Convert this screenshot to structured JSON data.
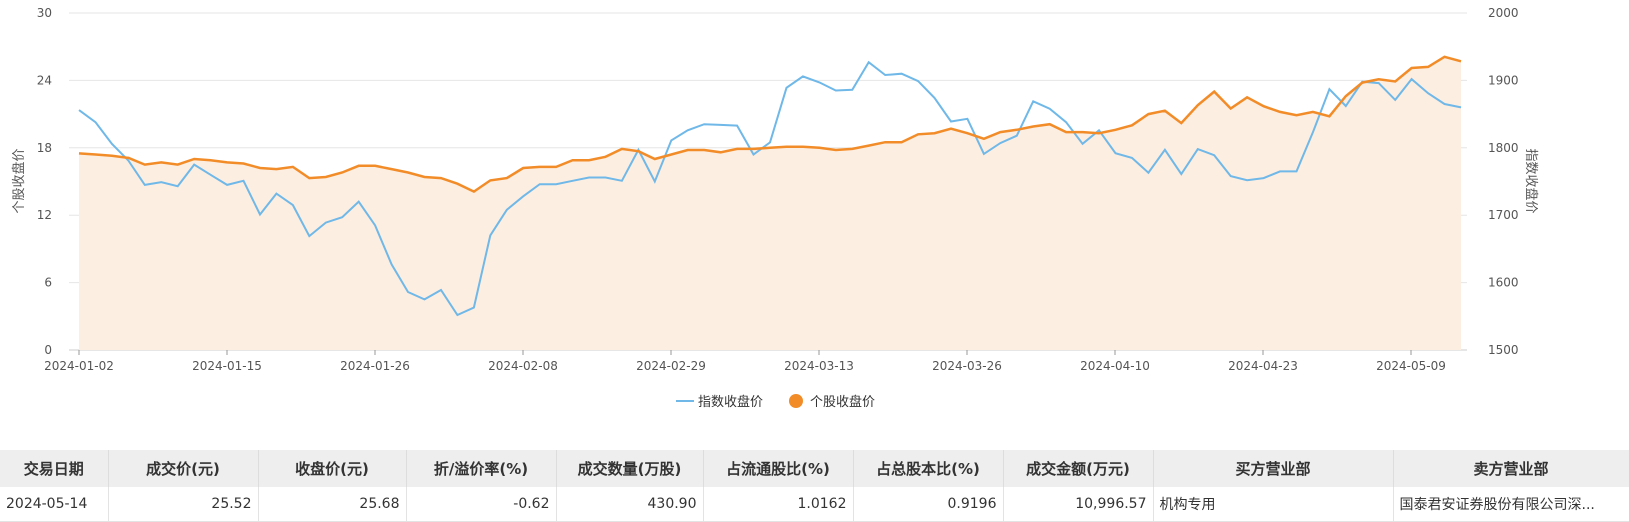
{
  "chart_data": {
    "type": "line",
    "legend": [
      "指数收盘价",
      "个股收盘价"
    ],
    "legend_position": "bottom-center",
    "grid": true,
    "y_left": {
      "label": "个股收盘价",
      "ylim": [
        0,
        30
      ],
      "ticks": [
        "30",
        "24",
        "18",
        "12",
        "6",
        "0"
      ]
    },
    "y_right": {
      "label": "指数收盘价",
      "ylim": [
        1500,
        2000
      ],
      "ticks": [
        "2000",
        "1900",
        "1800",
        "1700",
        "1600",
        "1500"
      ]
    },
    "x_ticks": [
      "2024-01-02",
      "2024-01-15",
      "2024-01-26",
      "2024-02-08",
      "2024-02-29",
      "2024-03-13",
      "2024-03-26",
      "2024-04-10",
      "2024-04-23",
      "2024-05-09"
    ],
    "series": [
      {
        "name": "指数收盘价",
        "axis": "right",
        "color": "#6fb8e8",
        "values": [
          1856,
          1838,
          1806,
          1781,
          1745,
          1749,
          1743,
          1775,
          1760,
          1745,
          1751,
          1701,
          1732,
          1715,
          1669,
          1689,
          1697,
          1720,
          1685,
          1627,
          1586,
          1575,
          1589,
          1552,
          1563,
          1670,
          1708,
          1728,
          1746,
          1746,
          1751,
          1756,
          1756,
          1751,
          1797,
          1750,
          1811,
          1826,
          1835,
          1834,
          1833,
          1790,
          1808,
          1889,
          1906,
          1897,
          1885,
          1886,
          1927,
          1908,
          1910,
          1899,
          1874,
          1839,
          1843,
          1791,
          1807,
          1818,
          1869,
          1858,
          1838,
          1806,
          1826,
          1792,
          1785,
          1763,
          1797,
          1761,
          1798,
          1789,
          1758,
          1752,
          1755,
          1765,
          1765,
          1823,
          1887,
          1862,
          1898,
          1896,
          1871,
          1902,
          1881,
          1865,
          1860
        ]
      },
      {
        "name": "个股收盘价",
        "axis": "left",
        "color": "#f28c28",
        "values": [
          17.5,
          17.4,
          17.3,
          17.1,
          16.5,
          16.7,
          16.5,
          17.0,
          16.9,
          16.7,
          16.6,
          16.2,
          16.1,
          16.3,
          15.3,
          15.4,
          15.8,
          16.4,
          16.4,
          16.1,
          15.8,
          15.4,
          15.3,
          14.8,
          14.1,
          15.1,
          15.3,
          16.2,
          16.3,
          16.3,
          16.9,
          16.9,
          17.2,
          17.9,
          17.7,
          17.0,
          17.4,
          17.8,
          17.8,
          17.6,
          17.9,
          17.9,
          18.0,
          18.1,
          18.1,
          18.0,
          17.8,
          17.9,
          18.2,
          18.5,
          18.5,
          19.2,
          19.3,
          19.7,
          19.3,
          18.8,
          19.4,
          19.6,
          19.9,
          20.1,
          19.4,
          19.4,
          19.3,
          19.6,
          20.0,
          21.0,
          21.3,
          20.2,
          21.8,
          23.0,
          21.5,
          22.5,
          21.7,
          21.2,
          20.9,
          21.2,
          20.8,
          22.6,
          23.8,
          24.1,
          23.9,
          25.1,
          25.2,
          26.1,
          25.7
        ]
      }
    ]
  },
  "table": {
    "headers": [
      "交易日期",
      "成交价(元)",
      "收盘价(元)",
      "折/溢价率(%)",
      "成交数量(万股)",
      "占流通股比(%)",
      "占总股本比(%)",
      "成交金额(万元)",
      "买方营业部",
      "卖方营业部"
    ],
    "rows": [
      [
        "2024-05-14",
        "25.52",
        "25.68",
        "-0.62",
        "430.90",
        "1.0162",
        "0.9196",
        "10,996.57",
        "机构专用",
        "国泰君安证券股份有限公司深..."
      ]
    ]
  }
}
